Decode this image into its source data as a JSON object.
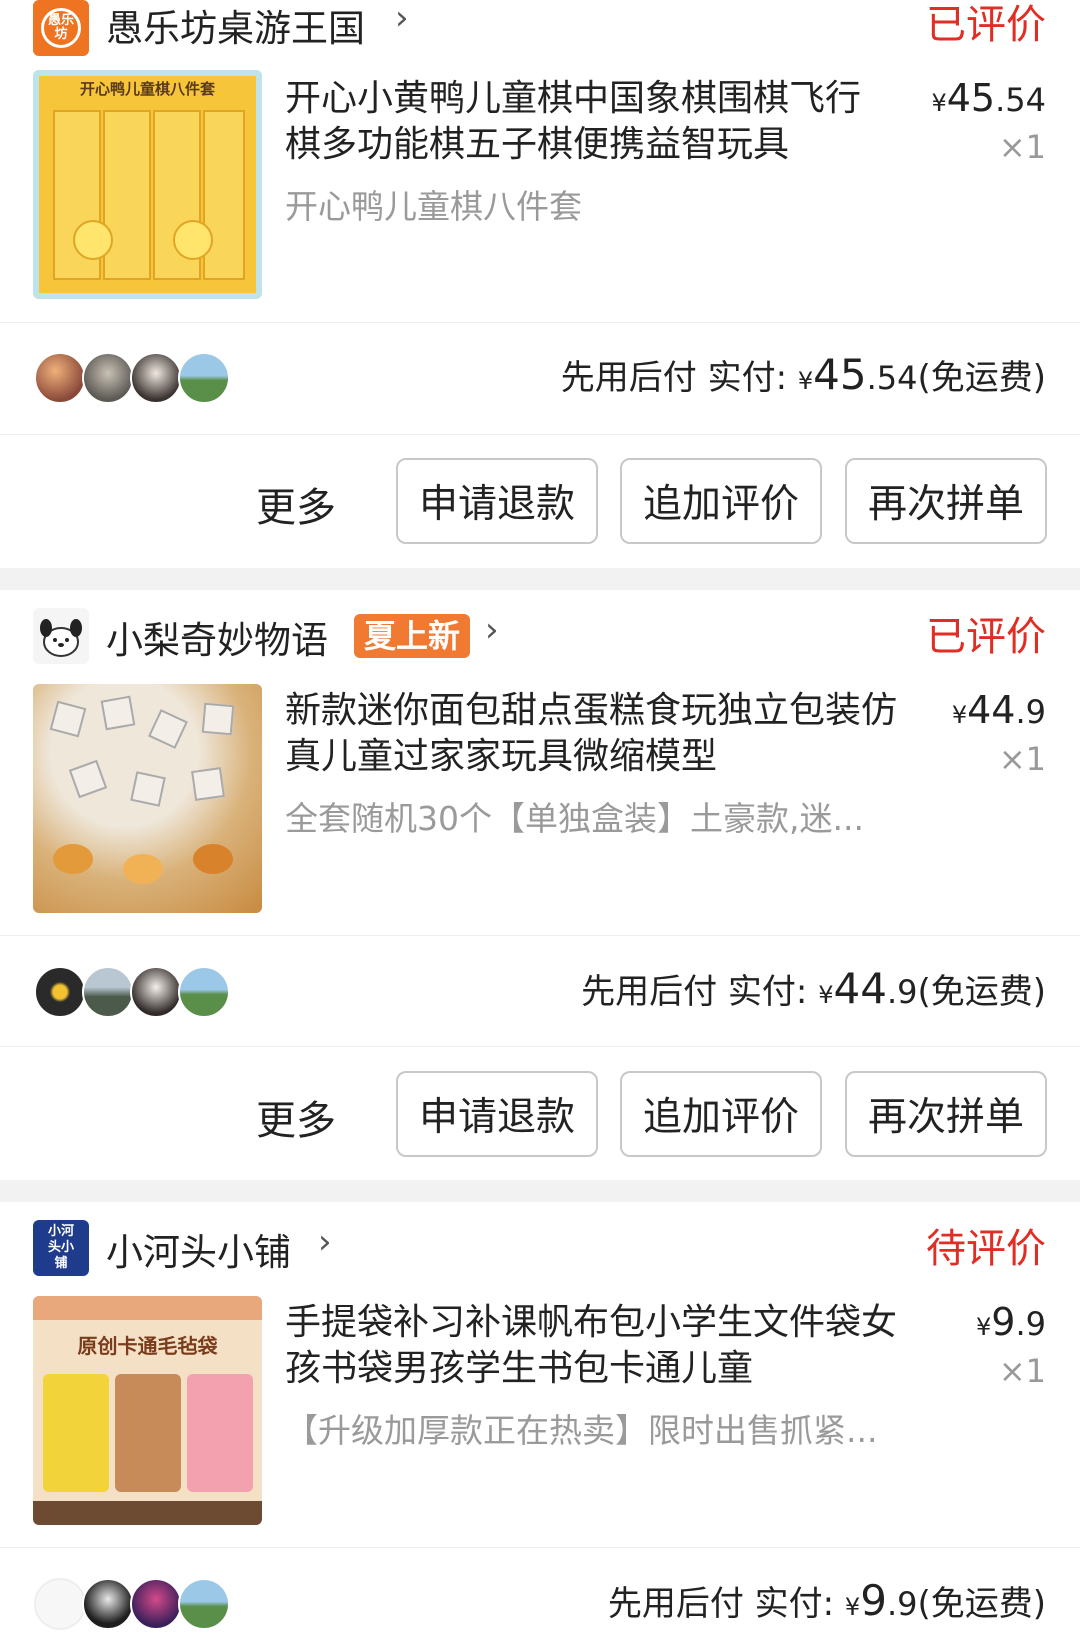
{
  "orders": [
    {
      "shop": {
        "name": "愚乐坊桌游王国",
        "logo_text": "愚乐坊",
        "tag": ""
      },
      "status": "已评价",
      "product": {
        "title": "开心小黄鸭儿童棋中国象棋围棋飞行棋多功能棋五子棋便携益智玩具",
        "variant": "开心鸭儿童棋八件套",
        "image_caption": "开心鸭儿童棋八件套",
        "price_yen": "¥",
        "price_int": "45",
        "price_dec": ".54",
        "qty": "×1"
      },
      "payment": {
        "label": "先用后付 实付: ",
        "yen": "¥",
        "int": "45",
        "dec": ".54",
        "ship": "(免运费)"
      },
      "actions": {
        "more": "更多",
        "refund": "申请退款",
        "add_review": "追加评价",
        "reorder": "再次拼单"
      }
    },
    {
      "shop": {
        "name": "小梨奇妙物语",
        "logo_text": "",
        "tag": "夏上新"
      },
      "status": "已评价",
      "product": {
        "title": "新款迷你面包甜点蛋糕食玩独立包装仿真儿童过家家玩具微缩模型",
        "variant": "全套随机30个【单独盒装】土豪款,迷...",
        "image_caption": "",
        "price_yen": "¥",
        "price_int": "44",
        "price_dec": ".9",
        "qty": "×1"
      },
      "payment": {
        "label": "先用后付 实付: ",
        "yen": "¥",
        "int": "44",
        "dec": ".9",
        "ship": "(免运费)"
      },
      "actions": {
        "more": "更多",
        "refund": "申请退款",
        "add_review": "追加评价",
        "reorder": "再次拼单"
      }
    },
    {
      "shop": {
        "name": "小河头小铺",
        "logo_text": "小河头小铺",
        "tag": ""
      },
      "status": "待评价",
      "product": {
        "title": "手提袋补习补课帆布包小学生文件袋女孩书袋男孩学生书包卡通儿童",
        "variant": "【升级加厚款正在热卖】限时出售抓紧...",
        "image_caption": "原创卡通毛毡袋",
        "price_yen": "¥",
        "price_int": "9",
        "price_dec": ".9",
        "qty": "×1"
      },
      "payment": {
        "label": "先用后付 实付: ",
        "yen": "¥",
        "int": "9",
        "dec": ".9",
        "ship": "(免运费)"
      }
    }
  ],
  "colors": {
    "status_red": "#e02e24",
    "tag_orange": "#f07a32",
    "logo_orange": "#ef7422",
    "logo_navy": "#1f3b8c"
  }
}
